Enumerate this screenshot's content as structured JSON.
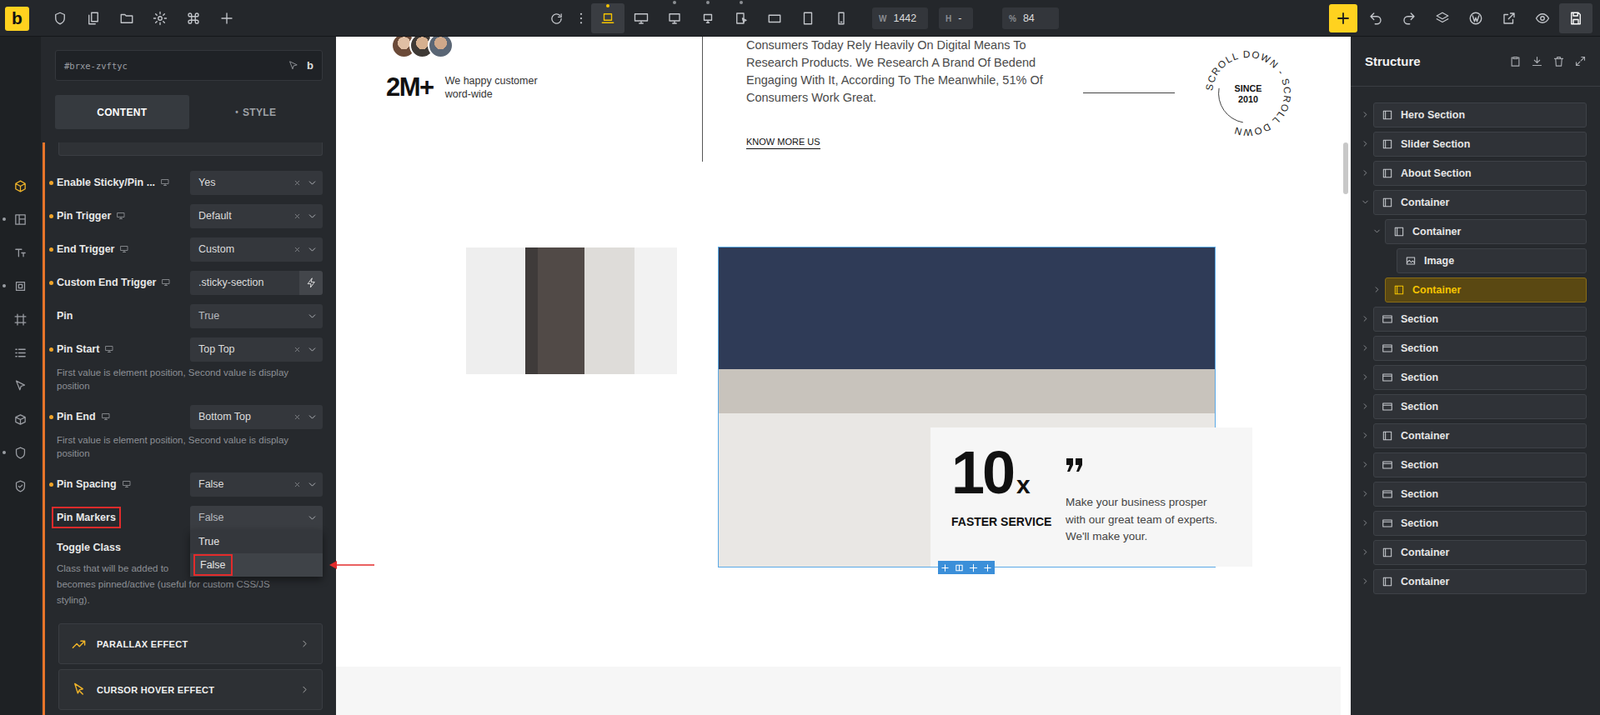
{
  "topbar": {
    "logo": "b",
    "devices": [
      {
        "selected": true,
        "dot": true
      },
      {
        "selected": false,
        "dot": false
      },
      {
        "selected": false,
        "dot": true
      },
      {
        "selected": false,
        "dot": true
      },
      {
        "selected": false,
        "dot": true
      },
      {
        "selected": false,
        "dot": false
      },
      {
        "selected": false,
        "dot": false
      },
      {
        "selected": false,
        "dot": false
      }
    ],
    "width": {
      "label": "W",
      "value": "1442"
    },
    "height": {
      "label": "H",
      "value": "-"
    },
    "zoom": {
      "label": "%",
      "value": "84"
    },
    "actions": [
      {
        "active": false
      },
      {
        "active": false
      },
      {
        "active": false
      },
      {
        "active": false
      },
      {
        "active": false
      },
      {
        "active": false
      },
      {
        "active": true
      }
    ]
  },
  "rail": [
    {
      "active": true,
      "dot": false
    },
    {
      "active": false,
      "dot": true
    },
    {
      "active": false,
      "dot": false
    },
    {
      "active": false,
      "dot": true
    },
    {
      "active": false,
      "dot": false
    },
    {
      "active": false,
      "dot": false
    },
    {
      "active": false,
      "dot": false
    },
    {
      "active": false,
      "dot": false
    },
    {
      "active": false,
      "dot": true
    },
    {
      "active": false,
      "dot": false
    }
  ],
  "panel": {
    "element_id": "#brxe-zvftyc",
    "id_logo": "b",
    "tabs": [
      {
        "label": "CONTENT",
        "selected": true
      },
      {
        "label": "STYLE",
        "dot": "•",
        "selected": false
      }
    ],
    "fields": [
      {
        "label": "Enable Sticky/Pin ...",
        "value": "Yes",
        "kind": "select",
        "modified": true,
        "responsive": true,
        "clearable": true
      },
      {
        "label": "Pin Trigger",
        "value": "Default",
        "kind": "select",
        "modified": true,
        "responsive": true,
        "clearable": true
      },
      {
        "label": "End Trigger",
        "value": "Custom",
        "kind": "select",
        "modified": true,
        "responsive": true,
        "clearable": true
      },
      {
        "label": "Custom End Trigger",
        "value": ".sticky-section",
        "kind": "input",
        "modified": true,
        "responsive": true,
        "dynamic": true
      },
      {
        "label": "Pin",
        "value": "True",
        "kind": "select",
        "modified": false,
        "responsive": false,
        "clearable": false
      },
      {
        "label": "Pin Start",
        "value": "Top Top",
        "kind": "select",
        "modified": true,
        "responsive": true,
        "clearable": true,
        "description": [
          "First value is element position, Second value is display",
          "position"
        ]
      },
      {
        "label": "Pin End",
        "value": "Bottom Top",
        "kind": "select",
        "modified": true,
        "responsive": true,
        "clearable": true,
        "description": [
          "First value is element position, Second value is display",
          "position"
        ]
      },
      {
        "label": "Pin Spacing",
        "value": "False",
        "kind": "select",
        "modified": true,
        "responsive": true,
        "clearable": true
      },
      {
        "label": "Pin Markers",
        "value": "False",
        "kind": "open-select",
        "modified": false,
        "responsive": false,
        "clearable": false,
        "highlighted": true,
        "options": [
          {
            "label": "True",
            "selected": false
          },
          {
            "label": "False",
            "selected": true
          }
        ]
      },
      {
        "label": "Toggle Class",
        "kind": "text",
        "modified": false,
        "responsive": false,
        "description": [
          "Class that will be added to",
          "becomes pinned/active (useful for custom CSS/JS",
          "styling)."
        ]
      }
    ],
    "accordions": [
      {
        "label": "PARALLAX EFFECT"
      },
      {
        "label": "CURSOR HOVER EFFECT"
      }
    ]
  },
  "annotations": {
    "label_box": true,
    "option_box": true,
    "arrow": true
  },
  "canvas": {
    "stat": "2M+",
    "stat_caption": [
      "We happy customer",
      "word-wide"
    ],
    "about_lines": [
      "Consumers Today Rely Heavily On Digital Means To",
      "Research Products. We Research A Brand Of Bedend",
      "Engaging With It, According To The Meanwhile, 51% Of",
      "Consumers Work Great."
    ],
    "link": "KNOW MORE US",
    "badge": {
      "ring": "SCROLL DOWN - SCROLL DOWN",
      "line1": "SINCE",
      "line2": "2010"
    },
    "feature": {
      "number": "10",
      "suffix": "x",
      "title": "FASTER SERVICE",
      "text": "Make your business prosper with our great team of experts. We'll make your."
    },
    "selected": true
  },
  "structure": {
    "title": "Structure",
    "items": [
      {
        "label": "Hero Section",
        "kind": "container",
        "depth": 0,
        "expandable": true,
        "expanded": false,
        "selected": false
      },
      {
        "label": "Slider Section",
        "kind": "container",
        "depth": 0,
        "expandable": true,
        "expanded": false,
        "selected": false
      },
      {
        "label": "About Section",
        "kind": "container",
        "depth": 0,
        "expandable": true,
        "expanded": false,
        "selected": false
      },
      {
        "label": "Container",
        "kind": "container",
        "depth": 0,
        "expandable": true,
        "expanded": true,
        "selected": false
      },
      {
        "label": "Container",
        "kind": "container",
        "depth": 1,
        "expandable": true,
        "expanded": true,
        "selected": false
      },
      {
        "label": "Image",
        "kind": "image",
        "depth": 2,
        "expandable": false,
        "expanded": false,
        "selected": false
      },
      {
        "label": "Container",
        "kind": "container",
        "depth": 1,
        "expandable": true,
        "expanded": false,
        "selected": true
      },
      {
        "label": "Section",
        "kind": "section",
        "depth": 0,
        "expandable": true,
        "expanded": false,
        "selected": false
      },
      {
        "label": "Section",
        "kind": "section",
        "depth": 0,
        "expandable": true,
        "expanded": false,
        "selected": false
      },
      {
        "label": "Section",
        "kind": "section",
        "depth": 0,
        "expandable": true,
        "expanded": false,
        "selected": false
      },
      {
        "label": "Section",
        "kind": "section",
        "depth": 0,
        "expandable": true,
        "expanded": false,
        "selected": false
      },
      {
        "label": "Container",
        "kind": "container",
        "depth": 0,
        "expandable": true,
        "expanded": false,
        "selected": false
      },
      {
        "label": "Section",
        "kind": "section",
        "depth": 0,
        "expandable": true,
        "expanded": false,
        "selected": false
      },
      {
        "label": "Section",
        "kind": "section",
        "depth": 0,
        "expandable": true,
        "expanded": false,
        "selected": false
      },
      {
        "label": "Section",
        "kind": "section",
        "depth": 0,
        "expandable": true,
        "expanded": false,
        "selected": false
      },
      {
        "label": "Container",
        "kind": "container",
        "depth": 0,
        "expandable": true,
        "expanded": false,
        "selected": false
      },
      {
        "label": "Container",
        "kind": "container",
        "depth": 0,
        "expandable": true,
        "expanded": false,
        "selected": false
      }
    ]
  }
}
